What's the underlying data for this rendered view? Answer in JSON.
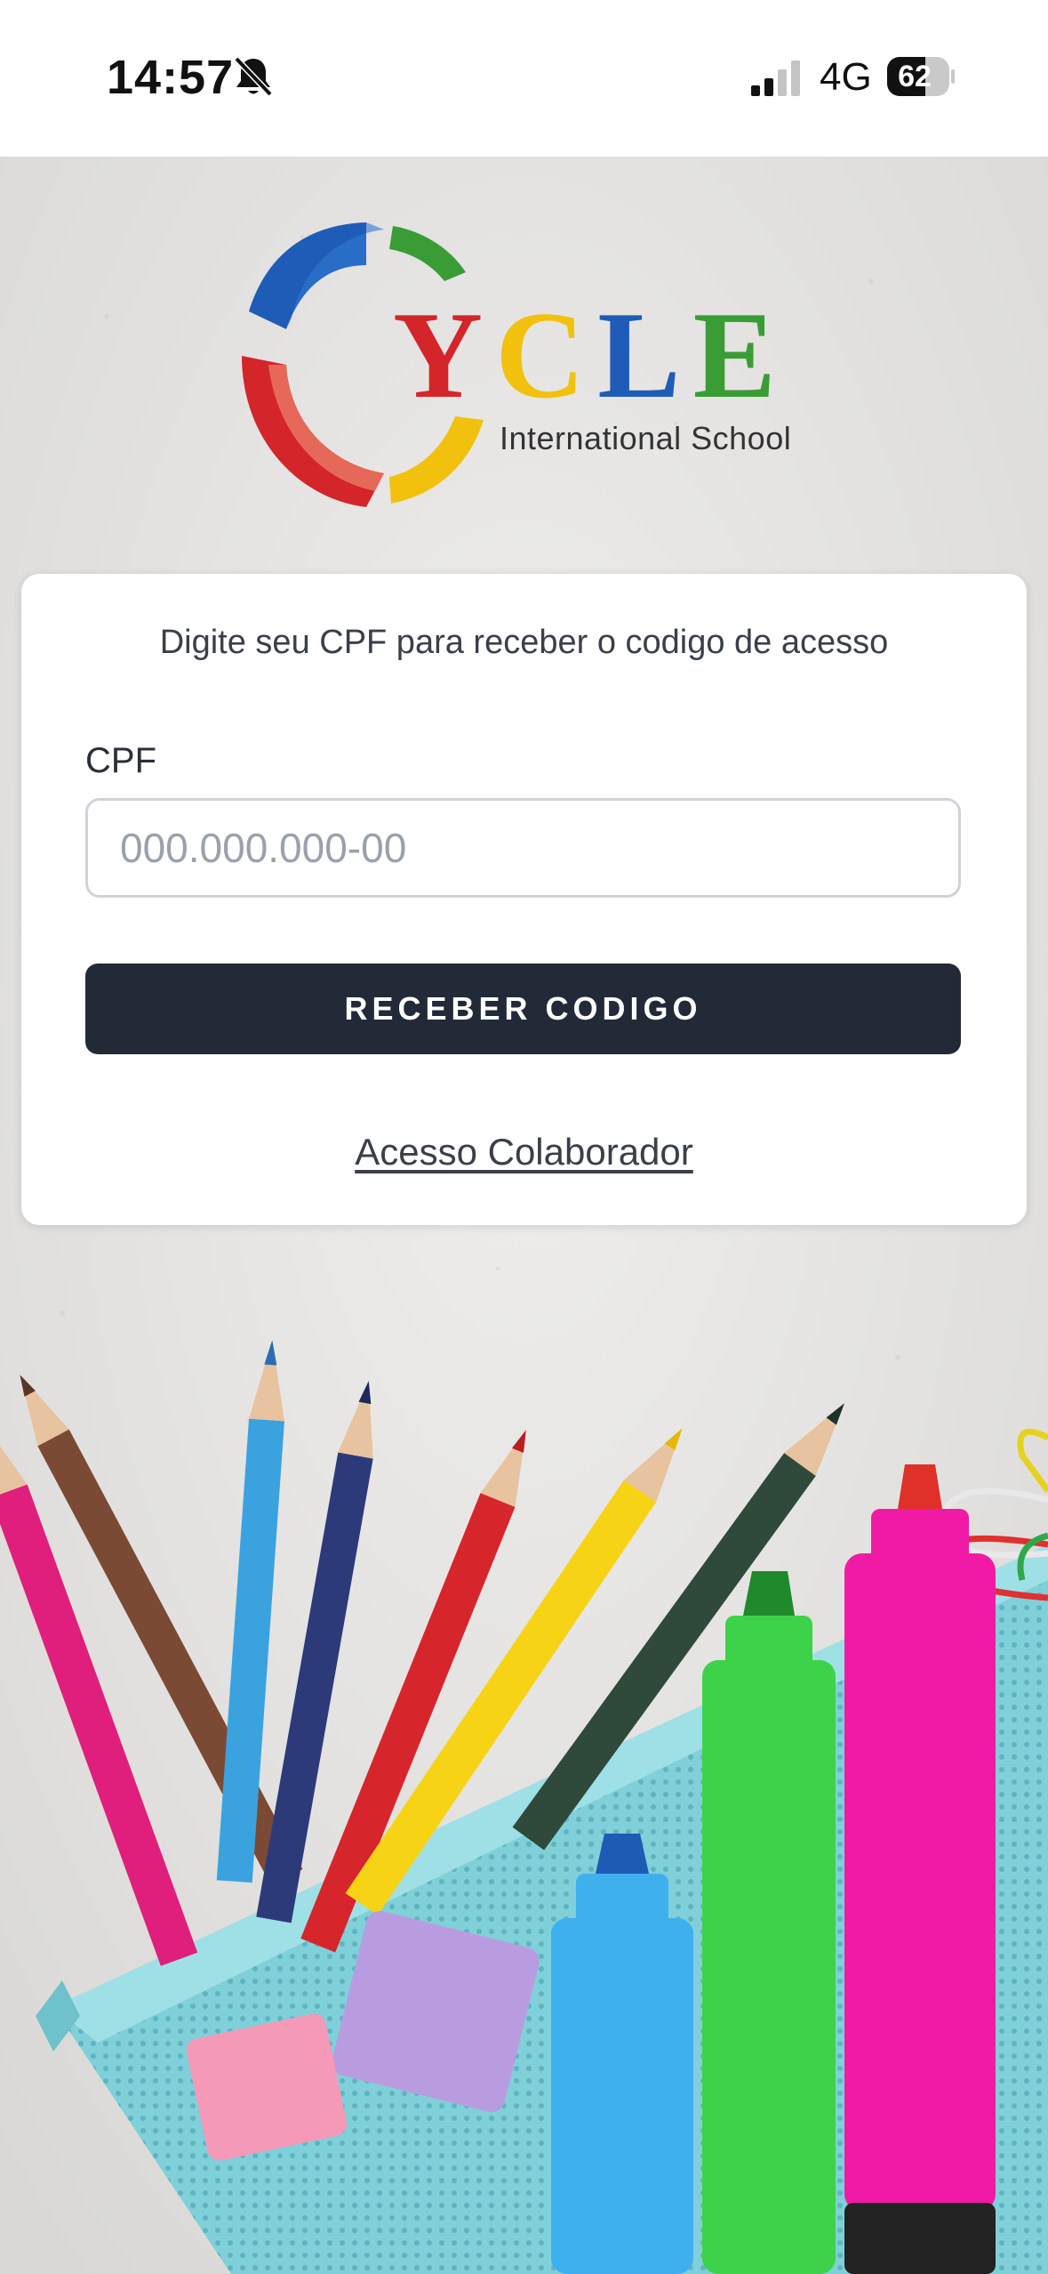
{
  "status_bar": {
    "time": "14:57",
    "network": "4G",
    "battery": "62",
    "battery_level": 0.62,
    "icons": [
      "bell-off-icon",
      "signal-icon",
      "battery-icon"
    ]
  },
  "logo": {
    "letters": [
      "Y",
      "C",
      "L",
      "E"
    ],
    "subtitle": "International School"
  },
  "form": {
    "instruction": "Digite seu CPF para receber o codigo de acesso",
    "cpf_label": "CPF",
    "cpf_value": "",
    "cpf_placeholder": "000.000.000-00",
    "submit_label": "RECEBER CODIGO",
    "collaborator_link": "Acesso Colaborador"
  },
  "colors": {
    "button_bg": "#222937",
    "logo_red": "#d4252b",
    "logo_yellow": "#f2c10e",
    "logo_blue": "#1f5cb7",
    "logo_green": "#3a9c35"
  }
}
